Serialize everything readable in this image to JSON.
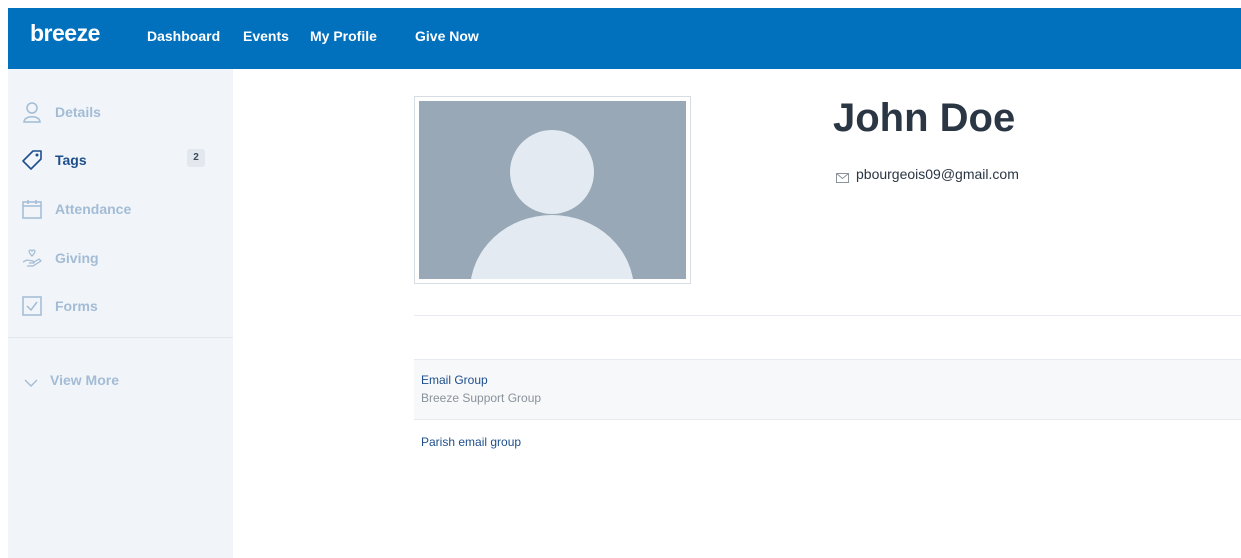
{
  "brand": {
    "logo_text": "breeze",
    "primary_color": "#0170bd"
  },
  "nav": {
    "items": [
      {
        "label": "Dashboard"
      },
      {
        "label": "Events"
      },
      {
        "label": "My Profile"
      },
      {
        "label": "Give Now"
      }
    ]
  },
  "sidebar": {
    "items": [
      {
        "label": "Details",
        "icon": "person-icon",
        "active": false
      },
      {
        "label": "Tags",
        "icon": "tag-icon",
        "active": true,
        "badge": "2"
      },
      {
        "label": "Attendance",
        "icon": "calendar-icon",
        "active": false
      },
      {
        "label": "Giving",
        "icon": "giving-hand-icon",
        "active": false
      },
      {
        "label": "Forms",
        "icon": "checkbox-icon",
        "active": false
      }
    ],
    "view_more_label": "View More"
  },
  "profile": {
    "name": "John Doe",
    "email": "pbourgeois09@gmail.com"
  },
  "groups": [
    {
      "title": "Email Group",
      "subtitle": "Breeze Support Group"
    },
    {
      "title": "Parish email group"
    }
  ]
}
